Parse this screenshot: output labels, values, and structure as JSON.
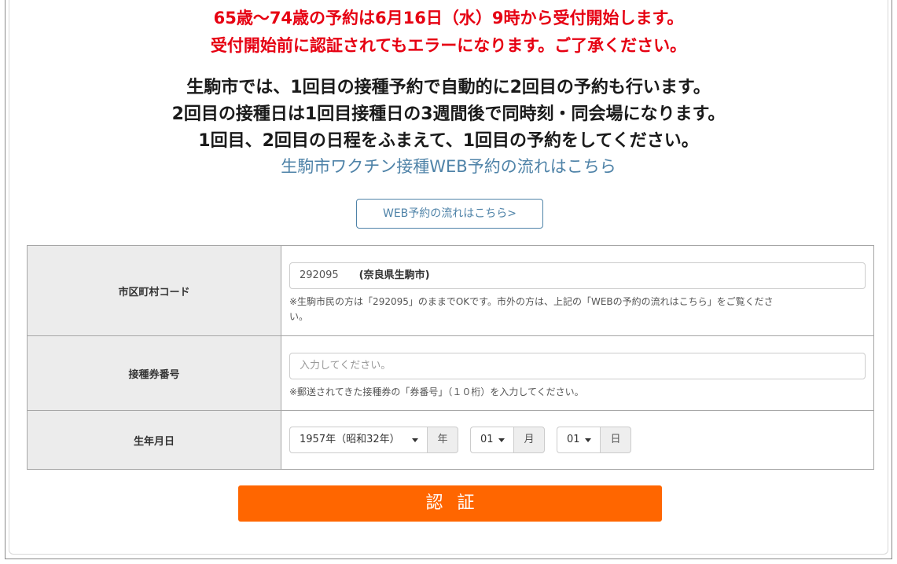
{
  "notices": {
    "red_line_1": "65歳～74歳の予約は6月16日（水）9時から受付開始します。",
    "red_line_2": "受付開始前に認証されてもエラーになります。ご了承ください。",
    "black_line_1": "生駒市では、1回目の接種予約で自動的に2回目の予約も行います。",
    "black_line_2": "2回目の接種日は1回目接種日の3週間後で同時刻・同会場になります。",
    "black_line_3": "1回目、2回目の日程をふまえて、1回目の予約をしてください。"
  },
  "flow_link_text": "生駒市ワクチン接種WEB予約の流れはこちら",
  "flow_button_label": "WEB予約の流れはこちら>",
  "form": {
    "municipality": {
      "label": "市区町村コード",
      "code": "292095",
      "name": "(奈良県生駒市)",
      "help_1": "※生駒市民の方は「292095」のままでOKです。市外の方は、上記の「WEBの予約の流れはこちら」をご覧くださ",
      "help_2": "い。"
    },
    "ticket": {
      "label": "接種券番号",
      "placeholder": "入力してください。",
      "help": "※郵送されてきた接種券の「券番号」（１０桁）を入力してください。"
    },
    "birthdate": {
      "label": "生年月日",
      "year_value": "1957年（昭和32年）",
      "year_unit": "年",
      "month_value": "01",
      "month_unit": "月",
      "day_value": "01",
      "day_unit": "日"
    }
  },
  "submit_label": "認証",
  "colors": {
    "alert_red": "#e60012",
    "link_blue": "#4f83a8",
    "submit_orange": "#ff6600"
  }
}
